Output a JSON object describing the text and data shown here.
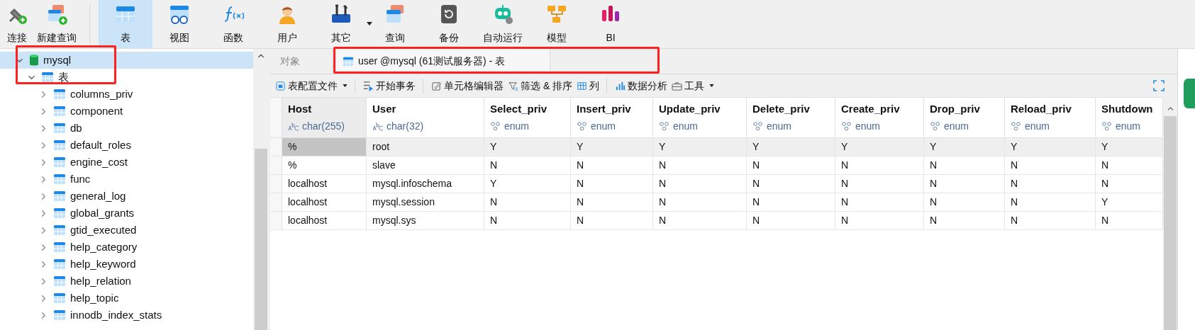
{
  "toolbar": [
    {
      "label": "连接",
      "kind": "plug",
      "selected": false,
      "dropdown": false
    },
    {
      "label": "新建查询",
      "kind": "newquery",
      "selected": false,
      "dropdown": false
    },
    {
      "label": "表",
      "kind": "table",
      "selected": true,
      "dropdown": false
    },
    {
      "label": "视图",
      "kind": "view",
      "selected": false,
      "dropdown": false
    },
    {
      "label": "函数",
      "kind": "function",
      "selected": false,
      "dropdown": false
    },
    {
      "label": "用户",
      "kind": "user",
      "selected": false,
      "dropdown": false
    },
    {
      "label": "其它",
      "kind": "tools",
      "selected": false,
      "dropdown": true
    },
    {
      "label": "查询",
      "kind": "query",
      "selected": false,
      "dropdown": false
    },
    {
      "label": "备份",
      "kind": "backup",
      "selected": false,
      "dropdown": false
    },
    {
      "label": "自动运行",
      "kind": "robot",
      "selected": false,
      "dropdown": false
    },
    {
      "label": "模型",
      "kind": "model",
      "selected": false,
      "dropdown": false
    },
    {
      "label": "BI",
      "kind": "bi",
      "selected": false,
      "dropdown": false
    }
  ],
  "tree": [
    {
      "label": "mysql",
      "kind": "database",
      "expanded": true,
      "selected": true,
      "children": [
        {
          "label": "表",
          "kind": "folder",
          "expanded": true,
          "selected": false,
          "children": [
            {
              "label": "columns_priv",
              "kind": "table",
              "expanded": false,
              "selected": false
            },
            {
              "label": "component",
              "kind": "table",
              "expanded": false,
              "selected": false
            },
            {
              "label": "db",
              "kind": "table",
              "expanded": false,
              "selected": false
            },
            {
              "label": "default_roles",
              "kind": "table",
              "expanded": false,
              "selected": false
            },
            {
              "label": "engine_cost",
              "kind": "table",
              "expanded": false,
              "selected": false
            },
            {
              "label": "func",
              "kind": "table",
              "expanded": false,
              "selected": false
            },
            {
              "label": "general_log",
              "kind": "table",
              "expanded": false,
              "selected": false
            },
            {
              "label": "global_grants",
              "kind": "table",
              "expanded": false,
              "selected": false
            },
            {
              "label": "gtid_executed",
              "kind": "table",
              "expanded": false,
              "selected": false
            },
            {
              "label": "help_category",
              "kind": "table",
              "expanded": false,
              "selected": false
            },
            {
              "label": "help_keyword",
              "kind": "table",
              "expanded": false,
              "selected": false
            },
            {
              "label": "help_relation",
              "kind": "table",
              "expanded": false,
              "selected": false
            },
            {
              "label": "help_topic",
              "kind": "table",
              "expanded": false,
              "selected": false
            },
            {
              "label": "innodb_index_stats",
              "kind": "table",
              "expanded": false,
              "selected": false
            }
          ]
        }
      ]
    }
  ],
  "tabs": [
    {
      "label": "对象",
      "kind": "plain",
      "selected": false
    },
    {
      "label": "user @mysql (61测试服务器) - 表",
      "kind": "table",
      "selected": true
    }
  ],
  "table_toolbar": [
    {
      "label": "表配置文件",
      "kind": "profile",
      "dropdown": true,
      "separator": true
    },
    {
      "label": "开始事务",
      "kind": "transaction",
      "dropdown": false,
      "separator": true
    },
    {
      "label": "单元格编辑器",
      "kind": "edit",
      "dropdown": false,
      "separator": false
    },
    {
      "label": "筛选 & 排序",
      "kind": "filter",
      "dropdown": false,
      "separator": false
    },
    {
      "label": "列",
      "kind": "columns",
      "dropdown": false,
      "separator": true
    },
    {
      "label": "数据分析",
      "kind": "chart",
      "dropdown": false,
      "separator": false
    },
    {
      "label": "工具",
      "kind": "toolbox",
      "dropdown": true,
      "separator": false
    }
  ],
  "table": {
    "columns": [
      {
        "name": "Host",
        "type": "char(255)",
        "kind": "text",
        "selected": true
      },
      {
        "name": "User",
        "type": "char(32)",
        "kind": "text",
        "selected": false
      },
      {
        "name": "Select_priv",
        "type": "enum",
        "kind": "enum",
        "selected": false
      },
      {
        "name": "Insert_priv",
        "type": "enum",
        "kind": "enum",
        "selected": false
      },
      {
        "name": "Update_priv",
        "type": "enum",
        "kind": "enum",
        "selected": false
      },
      {
        "name": "Delete_priv",
        "type": "enum",
        "kind": "enum",
        "selected": false
      },
      {
        "name": "Create_priv",
        "type": "enum",
        "kind": "enum",
        "selected": false
      },
      {
        "name": "Drop_priv",
        "type": "enum",
        "kind": "enum",
        "selected": false
      },
      {
        "name": "Reload_priv",
        "type": "enum",
        "kind": "enum",
        "selected": false
      },
      {
        "name": "Shutdown",
        "type": "enum",
        "kind": "enum",
        "selected": false
      }
    ],
    "rows": [
      {
        "selected": true,
        "cells": [
          {
            "text": "%",
            "focused": true
          },
          {
            "text": "root",
            "focused": false
          },
          {
            "text": "Y",
            "focused": false
          },
          {
            "text": "Y",
            "focused": false
          },
          {
            "text": "Y",
            "focused": false
          },
          {
            "text": "Y",
            "focused": false
          },
          {
            "text": "Y",
            "focused": false
          },
          {
            "text": "Y",
            "focused": false
          },
          {
            "text": "Y",
            "focused": false
          },
          {
            "text": "Y",
            "focused": false
          }
        ]
      },
      {
        "selected": false,
        "cells": [
          {
            "text": "%",
            "focused": false
          },
          {
            "text": "slave",
            "focused": false
          },
          {
            "text": "N",
            "focused": false
          },
          {
            "text": "N",
            "focused": false
          },
          {
            "text": "N",
            "focused": false
          },
          {
            "text": "N",
            "focused": false
          },
          {
            "text": "N",
            "focused": false
          },
          {
            "text": "N",
            "focused": false
          },
          {
            "text": "N",
            "focused": false
          },
          {
            "text": "N",
            "focused": false
          }
        ]
      },
      {
        "selected": false,
        "cells": [
          {
            "text": "localhost",
            "focused": false
          },
          {
            "text": "mysql.infoschema",
            "focused": false
          },
          {
            "text": "Y",
            "focused": false
          },
          {
            "text": "N",
            "focused": false
          },
          {
            "text": "N",
            "focused": false
          },
          {
            "text": "N",
            "focused": false
          },
          {
            "text": "N",
            "focused": false
          },
          {
            "text": "N",
            "focused": false
          },
          {
            "text": "N",
            "focused": false
          },
          {
            "text": "N",
            "focused": false
          }
        ]
      },
      {
        "selected": false,
        "cells": [
          {
            "text": "localhost",
            "focused": false
          },
          {
            "text": "mysql.session",
            "focused": false
          },
          {
            "text": "N",
            "focused": false
          },
          {
            "text": "N",
            "focused": false
          },
          {
            "text": "N",
            "focused": false
          },
          {
            "text": "N",
            "focused": false
          },
          {
            "text": "N",
            "focused": false
          },
          {
            "text": "N",
            "focused": false
          },
          {
            "text": "N",
            "focused": false
          },
          {
            "text": "Y",
            "focused": false
          }
        ]
      },
      {
        "selected": false,
        "cells": [
          {
            "text": "localhost",
            "focused": false
          },
          {
            "text": "mysql.sys",
            "focused": false
          },
          {
            "text": "N",
            "focused": false
          },
          {
            "text": "N",
            "focused": false
          },
          {
            "text": "N",
            "focused": false
          },
          {
            "text": "N",
            "focused": false
          },
          {
            "text": "N",
            "focused": false
          },
          {
            "text": "N",
            "focused": false
          },
          {
            "text": "N",
            "focused": false
          },
          {
            "text": "N",
            "focused": false
          }
        ]
      }
    ]
  }
}
